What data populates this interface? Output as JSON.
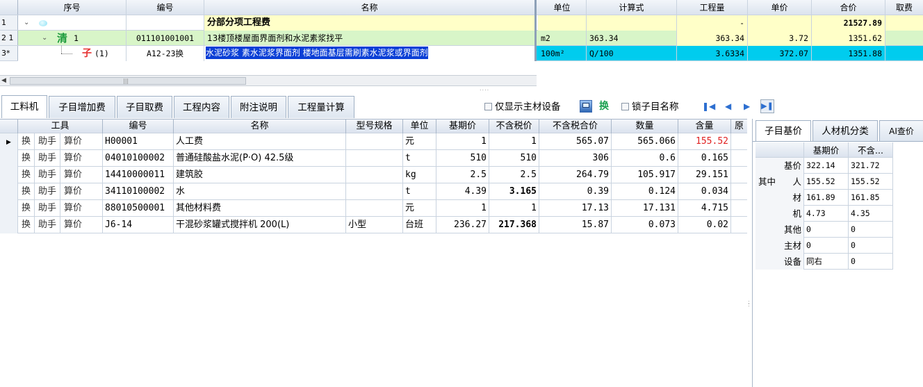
{
  "top_grid": {
    "headers": [
      "序号",
      "编号",
      "名称",
      "单位",
      "计算式",
      "工程量",
      "单价",
      "合价",
      "取费"
    ],
    "rows": [
      {
        "rownum": "1",
        "type_icon": "",
        "seq": "",
        "code": "",
        "name": "分部分项工程费",
        "unit": "",
        "formula": "",
        "qty": "-",
        "price": "",
        "total": "21527.89"
      },
      {
        "rownum": "2 1",
        "type_icon": "清",
        "seq": "1",
        "code": "011101001001",
        "name": "13楼顶楼屋面界面剂和水泥素浆找平",
        "unit": "m2",
        "formula": "363.34",
        "qty": "363.34",
        "price": "3.72",
        "total": "1351.62"
      },
      {
        "rownum": "3*",
        "type_icon": "子",
        "seq": "(1)",
        "code": "A12-23换",
        "name": "水泥砂浆 素水泥浆界面剂 楼地面基层需刷素水泥浆或界面剂",
        "unit": "100m²",
        "formula": "Q/100",
        "qty": "3.6334",
        "price": "372.07",
        "total": "1351.88"
      }
    ]
  },
  "tabs": [
    "工料机",
    "子目增加费",
    "子目取费",
    "工程内容",
    "附注说明",
    "工程量计算"
  ],
  "toolbar": {
    "only_main_label": "仅显示主材设备",
    "swap_label": "换",
    "lock_label": "锁子目名称"
  },
  "bottom_grid": {
    "headers": [
      "工具",
      "编号",
      "名称",
      "型号规格",
      "单位",
      "基期价",
      "不含税价",
      "不含税合价",
      "数量",
      "含量",
      "原"
    ],
    "tool_buttons": [
      "换",
      "助手",
      "算价"
    ],
    "rows": [
      {
        "code": "H00001",
        "name": "人工费",
        "spec": "",
        "unit": "元",
        "base": "1",
        "notax": "1",
        "notax_total": "565.07",
        "qty": "565.066",
        "content": "155.52"
      },
      {
        "code": "04010100002",
        "name": "普通硅酸盐水泥(P·O) 42.5级",
        "spec": "",
        "unit": "t",
        "base": "510",
        "notax": "510",
        "notax_total": "306",
        "qty": "0.6",
        "content": "0.165"
      },
      {
        "code": "14410000011",
        "name": "建筑胶",
        "spec": "",
        "unit": "kg",
        "base": "2.5",
        "notax": "2.5",
        "notax_total": "264.79",
        "qty": "105.917",
        "content": "29.151"
      },
      {
        "code": "34110100002",
        "name": "水",
        "spec": "",
        "unit": "t",
        "base": "4.39",
        "notax": "3.165",
        "notax_total": "0.39",
        "qty": "0.124",
        "content": "0.034"
      },
      {
        "code": "88010500001",
        "name": "其他材料费",
        "spec": "",
        "unit": "元",
        "base": "1",
        "notax": "1",
        "notax_total": "17.13",
        "qty": "17.131",
        "content": "4.715"
      },
      {
        "code": "J6-14",
        "name": "干混砂浆罐式搅拌机 200(L)",
        "spec": "小型",
        "unit": "台班",
        "base": "236.27",
        "notax": "217.368",
        "notax_total": "15.87",
        "qty": "0.073",
        "content": "0.02"
      }
    ]
  },
  "right_panel": {
    "tabs": [
      "子目基价",
      "人材机分类",
      "AI查价"
    ],
    "headers": [
      "基期价",
      "不含..."
    ],
    "rows": [
      {
        "label": "基价",
        "prefix": "",
        "base": "322.14",
        "notax": "321.72"
      },
      {
        "label": "人",
        "prefix": "其中",
        "base": "155.52",
        "notax": "155.52"
      },
      {
        "label": "材",
        "prefix": "",
        "base": "161.89",
        "notax": "161.85"
      },
      {
        "label": "机",
        "prefix": "",
        "base": "4.73",
        "notax": "4.35"
      },
      {
        "label": "其他",
        "prefix": "",
        "base": "0",
        "notax": "0"
      },
      {
        "label": "主材",
        "prefix": "",
        "base": "0",
        "notax": "0"
      },
      {
        "label": "设备",
        "prefix": "",
        "base": "同右",
        "notax": "0"
      }
    ]
  },
  "colors": {
    "row1_name_bg": "#ffffc8",
    "row2_bg": "#d8f5c8",
    "row3_bg": "#00ccee",
    "selected_text_bg": "#0a3fd6",
    "content_red": "#e02020"
  }
}
